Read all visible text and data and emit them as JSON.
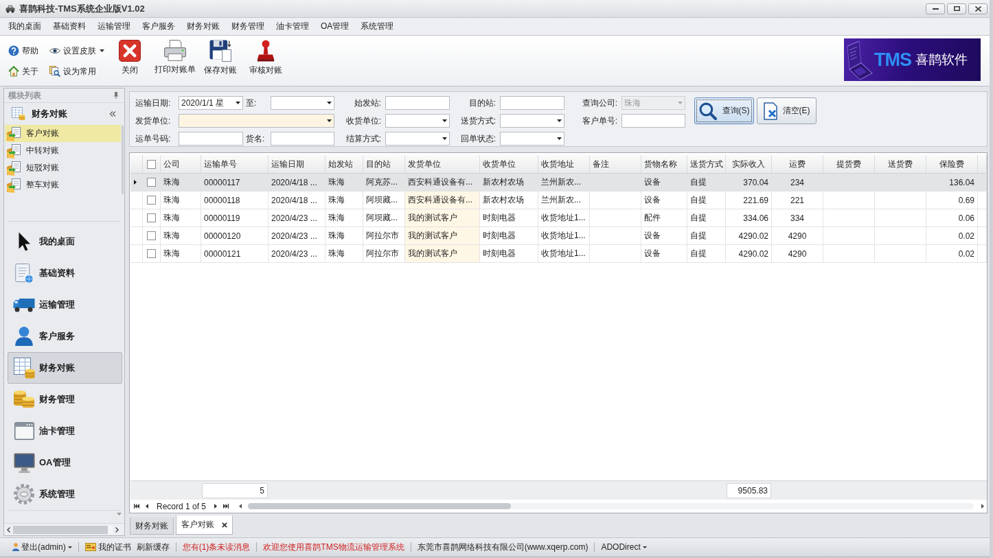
{
  "window": {
    "title": "喜鹊科技-TMS系统企业版V1.02"
  },
  "menu": [
    "我的桌面",
    "基础资料",
    "运输管理",
    "客户服务",
    "财务对账",
    "财务管理",
    "油卡管理",
    "OA管理",
    "系统管理"
  ],
  "toolbar": {
    "small": [
      {
        "label": "帮助",
        "dropdown": false
      },
      {
        "label": "设置皮肤",
        "dropdown": true
      },
      {
        "label": "关于",
        "dropdown": false
      },
      {
        "label": "设为常用",
        "dropdown": false
      }
    ],
    "large": [
      "关闭",
      "打印对账单",
      "保存对账",
      "审核对账"
    ]
  },
  "logo": {
    "mark": "TMS",
    "name": "喜鹊软件"
  },
  "sidebar": {
    "title": "模块列表",
    "group": {
      "title": "财务对账",
      "items": [
        {
          "label": "客户对账",
          "selected": true
        },
        {
          "label": "中转对账",
          "selected": false
        },
        {
          "label": "短驳对账",
          "selected": false
        },
        {
          "label": "整车对账",
          "selected": false
        }
      ]
    },
    "nav": [
      {
        "label": "我的桌面",
        "selected": false
      },
      {
        "label": "基础资料",
        "selected": false
      },
      {
        "label": "运输管理",
        "selected": false
      },
      {
        "label": "客户服务",
        "selected": false
      },
      {
        "label": "财务对账",
        "selected": true
      },
      {
        "label": "财务管理",
        "selected": false
      },
      {
        "label": "油卡管理",
        "selected": false
      },
      {
        "label": "OA管理",
        "selected": false
      },
      {
        "label": "系统管理",
        "selected": false
      }
    ]
  },
  "filters": [
    [
      {
        "label": "运输日期:",
        "kind": "combo",
        "value": "2020/1/1 星",
        "disabled": false,
        "focused": false
      },
      {
        "label": "至:",
        "kind": "combo",
        "disabled": false,
        "focused": false
      },
      {
        "label": "始发站:",
        "kind": "text",
        "disabled": false,
        "focused": false
      },
      {
        "label": "目的站:",
        "kind": "text",
        "disabled": false,
        "focused": false
      },
      {
        "label": "查询公司:",
        "kind": "combo",
        "value": "珠海",
        "disabled": true,
        "focused": false
      }
    ],
    [
      {
        "label": "发货单位:",
        "kind": "combo",
        "disabled": false,
        "focused": true
      },
      {
        "label": "收货单位:",
        "kind": "combo",
        "disabled": false,
        "focused": false
      },
      {
        "label": "送货方式:",
        "kind": "combo",
        "disabled": false,
        "focused": false
      },
      {
        "label": "客户单号:",
        "kind": "text",
        "disabled": false,
        "focused": false
      }
    ],
    [
      {
        "label": "运单号码:",
        "kind": "text",
        "disabled": false,
        "focused": false
      },
      {
        "label": "货名:",
        "kind": "text",
        "disabled": false,
        "focused": false
      },
      {
        "label": "结算方式:",
        "kind": "combo",
        "disabled": false,
        "focused": false
      },
      {
        "label": "回单状态:",
        "kind": "combo",
        "disabled": false,
        "focused": false
      }
    ]
  ],
  "filter_buttons": [
    {
      "label": "查询(S)",
      "focused": true
    },
    {
      "label": "清空(E)",
      "focused": false
    }
  ],
  "table": {
    "all_checked": false,
    "columns": [
      {
        "label": "公司",
        "kind": "text",
        "highlighted": false
      },
      {
        "label": "运输单号",
        "kind": "text",
        "highlighted": false
      },
      {
        "label": "运输日期",
        "kind": "text",
        "highlighted": false
      },
      {
        "label": "始发站",
        "kind": "text",
        "highlighted": false
      },
      {
        "label": "目的站",
        "kind": "text",
        "highlighted": false
      },
      {
        "label": "发货单位",
        "kind": "text",
        "highlighted": true
      },
      {
        "label": "收货单位",
        "kind": "text",
        "highlighted": false
      },
      {
        "label": "收货地址",
        "kind": "text",
        "highlighted": false
      },
      {
        "label": "备注",
        "kind": "text",
        "highlighted": false
      },
      {
        "label": "货物名称",
        "kind": "text",
        "highlighted": false
      },
      {
        "label": "送货方式",
        "kind": "text",
        "highlighted": false
      },
      {
        "label": "实际收入",
        "kind": "number",
        "highlighted": false
      },
      {
        "label": "运费",
        "kind": "center",
        "highlighted": false
      },
      {
        "label": "提货费",
        "kind": "center",
        "highlighted": false
      },
      {
        "label": "送货费",
        "kind": "center",
        "highlighted": false
      },
      {
        "label": "保险费",
        "kind": "number",
        "highlighted": false
      }
    ],
    "rows": [
      {
        "selected": true,
        "checked": false,
        "company": "珠海",
        "waybill_no": "00000117",
        "ship_date": "2020/4/18 ...",
        "origin": "珠海",
        "destination": "阿克苏...",
        "shipper": "西安科通设备有...",
        "consignee": "新农村农场",
        "address": "兰州新农...",
        "goods": "设备",
        "delivery": "自提",
        "income": "370.04",
        "freight": "234",
        "insurance": "136.04"
      },
      {
        "selected": false,
        "checked": false,
        "company": "珠海",
        "waybill_no": "00000118",
        "ship_date": "2020/4/18 ...",
        "origin": "珠海",
        "destination": "阿坝藏...",
        "shipper": "西安科通设备有...",
        "consignee": "新农村农场",
        "address": "兰州新农...",
        "goods": "设备",
        "delivery": "自提",
        "income": "221.69",
        "freight": "221",
        "insurance": "0.69"
      },
      {
        "selected": false,
        "checked": false,
        "company": "珠海",
        "waybill_no": "00000119",
        "ship_date": "2020/4/23 ...",
        "origin": "珠海",
        "destination": "阿坝藏...",
        "shipper": "我的测试客户",
        "consignee": "时刻电器",
        "address": "收货地址1...",
        "goods": "配件",
        "delivery": "自提",
        "income": "334.06",
        "freight": "334",
        "insurance": "0.06"
      },
      {
        "selected": false,
        "checked": false,
        "company": "珠海",
        "waybill_no": "00000120",
        "ship_date": "2020/4/23 ...",
        "origin": "珠海",
        "destination": "阿拉尔市",
        "shipper": "我的测试客户",
        "consignee": "时刻电器",
        "address": "收货地址1...",
        "goods": "设备",
        "delivery": "自提",
        "income": "4290.02",
        "freight": "4290",
        "insurance": "0.02"
      },
      {
        "selected": false,
        "checked": false,
        "company": "珠海",
        "waybill_no": "00000121",
        "ship_date": "2020/4/23 ...",
        "origin": "珠海",
        "destination": "阿拉尔市",
        "shipper": "我的测试客户",
        "consignee": "时刻电器",
        "address": "收货地址1...",
        "goods": "设备",
        "delivery": "自提",
        "income": "4290.02",
        "freight": "4290",
        "insurance": "0.02"
      }
    ]
  },
  "footer": {
    "count": "5",
    "total_income": "9505.83"
  },
  "navigator": {
    "record": "Record 1 of 5"
  },
  "tabs": [
    {
      "label": "财务对账",
      "selected": false
    },
    {
      "label": "客户对账",
      "selected": true
    }
  ],
  "status_bar": [
    {
      "items": [
        {
          "label": "登出(admin)",
          "kind": "user"
        }
      ]
    },
    {
      "items": [
        {
          "label": "我的证书",
          "kind": "certificate"
        },
        {
          "label": "刷新缓存",
          "kind": "link"
        }
      ]
    },
    {
      "items": [
        {
          "label": "您有(1)条未读消息",
          "kind": "notice"
        }
      ]
    },
    {
      "items": [
        {
          "label": "欢迎您使用喜鹊TMS物流运输管理系统",
          "kind": "notice"
        }
      ]
    },
    {
      "items": [
        {
          "label": "东莞市喜鹊网络科技有限公司(www.xqerp.com)",
          "kind": "text"
        }
      ]
    },
    {
      "items": [
        {
          "label": "ADODirect",
          "kind": "menu"
        }
      ]
    }
  ]
}
